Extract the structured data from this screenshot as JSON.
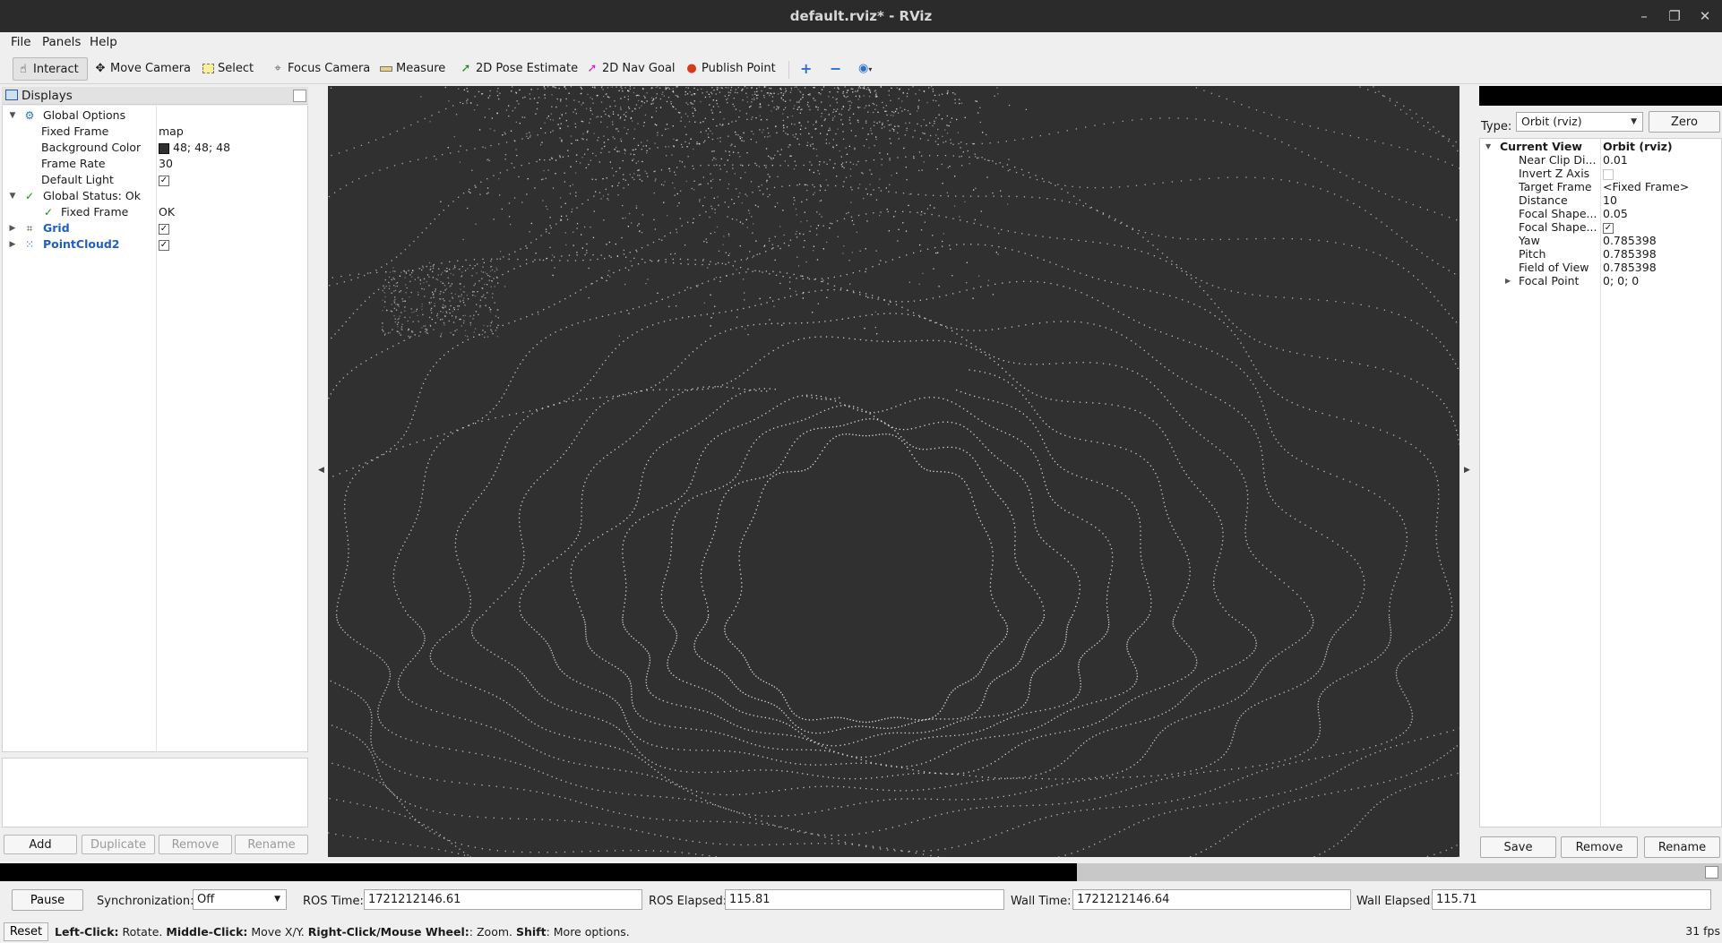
{
  "window": {
    "title": "default.rviz* - RViz"
  },
  "menu": {
    "file": "File",
    "panels": "Panels",
    "help": "Help"
  },
  "toolbar": {
    "interact": "Interact",
    "move_camera": "Move Camera",
    "select": "Select",
    "focus_camera": "Focus Camera",
    "measure": "Measure",
    "pose_estimate": "2D Pose Estimate",
    "nav_goal": "2D Nav Goal",
    "publish_point": "Publish Point"
  },
  "displays": {
    "title": "Displays",
    "global_options": "Global Options",
    "fixed_frame_label": "Fixed Frame",
    "fixed_frame_value": "map",
    "bg_color_label": "Background Color",
    "bg_color_value": "48; 48; 48",
    "bg_color_hex": "#303030",
    "frame_rate_label": "Frame Rate",
    "frame_rate_value": "30",
    "default_light_label": "Default Light",
    "default_light_checked": true,
    "global_status": "Global Status: Ok",
    "status_fixed_frame_label": "Fixed Frame",
    "status_fixed_frame_value": "OK",
    "grid_label": "Grid",
    "grid_checked": true,
    "pointcloud_label": "PointCloud2",
    "pointcloud_checked": true,
    "buttons": {
      "add": "Add",
      "duplicate": "Duplicate",
      "remove": "Remove",
      "rename": "Rename"
    }
  },
  "views": {
    "type_label": "Type:",
    "type_value": "Orbit (rviz)",
    "zero": "Zero",
    "current_view": "Current View",
    "current_view_value": "Orbit (rviz)",
    "props": [
      {
        "label": "Near Clip Di...",
        "value": "0.01"
      },
      {
        "label": "Invert Z Axis",
        "value": ""
      },
      {
        "label": "Target Frame",
        "value": "<Fixed Frame>"
      },
      {
        "label": "Distance",
        "value": "10"
      },
      {
        "label": "Focal Shape...",
        "value": "0.05"
      },
      {
        "label": "Focal Shape...",
        "value": ""
      },
      {
        "label": "Yaw",
        "value": "0.785398"
      },
      {
        "label": "Pitch",
        "value": "0.785398"
      },
      {
        "label": "Field of View",
        "value": "0.785398"
      },
      {
        "label": "Focal Point",
        "value": "0; 0; 0"
      }
    ],
    "buttons": {
      "save": "Save",
      "remove": "Remove",
      "rename": "Rename"
    }
  },
  "time": {
    "pause": "Pause",
    "sync_label": "Synchronization:",
    "sync_value": "Off",
    "ros_time_label": "ROS Time:",
    "ros_time": "1721212146.61",
    "ros_elapsed_label": "ROS Elapsed:",
    "ros_elapsed": "115.81",
    "wall_time_label": "Wall Time:",
    "wall_time": "1721212146.64",
    "wall_elapsed_label": "Wall Elapsed:",
    "wall_elapsed": "115.71"
  },
  "status": {
    "reset": "Reset",
    "left_click": "Left-Click:",
    "left_click_desc": " Rotate. ",
    "middle_click": "Middle-Click:",
    "middle_click_desc": " Move X/Y. ",
    "right_click": "Right-Click/Mouse Wheel:",
    "right_click_desc": ": Zoom. ",
    "shift": "Shift",
    "shift_desc": ": More options.",
    "fps": "31 fps"
  }
}
